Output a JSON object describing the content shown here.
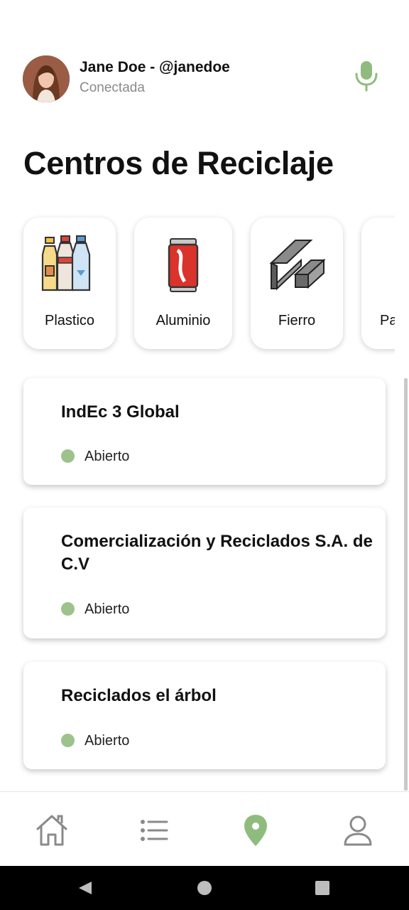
{
  "user": {
    "name": "Jane Doe - @janedoe",
    "status": "Conectada"
  },
  "page": {
    "title": "Centros de Reciclaje"
  },
  "categories": [
    {
      "label": "Plastico",
      "icon": "plastic-bottles-icon"
    },
    {
      "label": "Aluminio",
      "icon": "aluminum-can-icon"
    },
    {
      "label": "Fierro",
      "icon": "iron-beams-icon"
    },
    {
      "label": "Pa",
      "icon": "paper-icon"
    }
  ],
  "centers": [
    {
      "name": "IndEc 3 Global",
      "status": "Abierto"
    },
    {
      "name": "Comercialización y Reciclados S.A. de C.V",
      "status": "Abierto"
    },
    {
      "name": "Reciclados el árbol",
      "status": "Abierto"
    }
  ],
  "nav": [
    {
      "icon": "home-icon"
    },
    {
      "icon": "list-icon"
    },
    {
      "icon": "map-pin-icon",
      "active": true
    },
    {
      "icon": "user-icon"
    }
  ],
  "colors": {
    "accent": "#8fbc7e",
    "status_open": "#9dc28c",
    "nav_inactive": "#8a8a8a"
  }
}
